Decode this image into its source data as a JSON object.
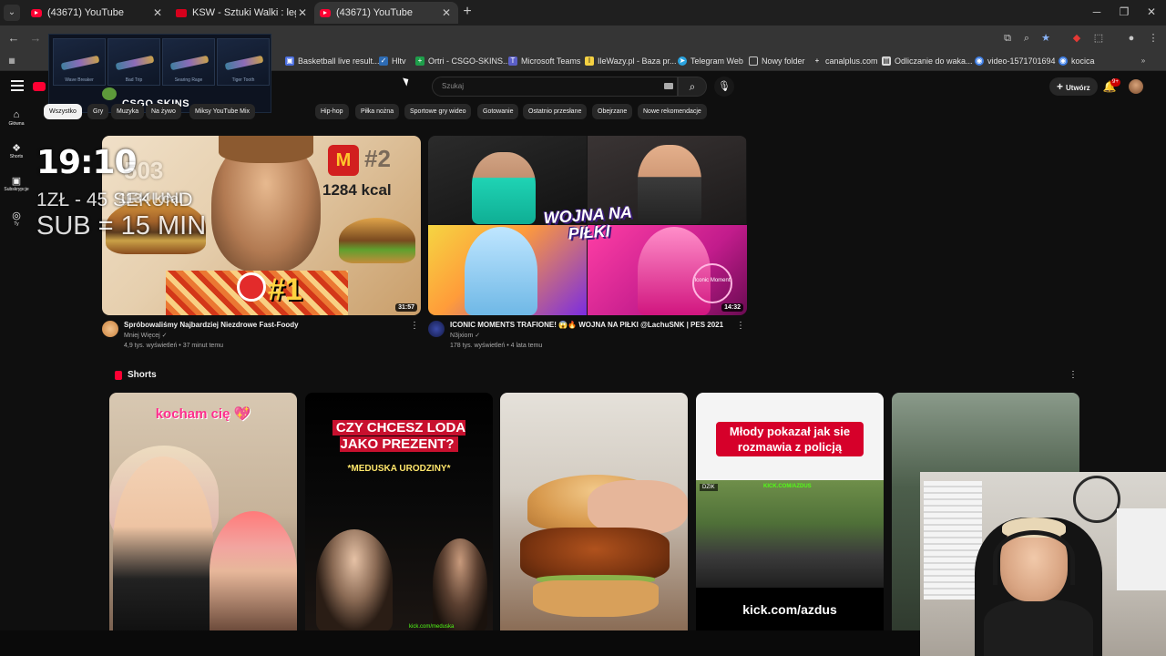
{
  "browser": {
    "tabs": [
      {
        "title": "(43671) YouTube",
        "favicon": "youtube-icon",
        "active": false
      },
      {
        "title": "KSW - Sztuki Walki : legalny bu",
        "favicon": "ksw-icon",
        "active": false
      },
      {
        "title": "(43671) YouTube",
        "favicon": "youtube-icon",
        "active": true
      }
    ],
    "new_tab": "+",
    "window_controls": {
      "minimize": "─",
      "maximize": "❐",
      "close": "✕"
    },
    "bookmarks": [
      {
        "label": "Basketball live result..."
      },
      {
        "label": "Hltv"
      },
      {
        "label": "Ortri - CSGO-SKINS..."
      },
      {
        "label": "Microsoft Teams"
      },
      {
        "label": "IleWazy.pl - Baza pr..."
      },
      {
        "label": "Telegram Web"
      },
      {
        "label": "Nowy folder"
      },
      {
        "label": "canalplus.com"
      },
      {
        "label": "Odliczanie do waka..."
      },
      {
        "label": "video-1571701694"
      },
      {
        "label": "kocica"
      }
    ]
  },
  "overlay_ad": {
    "brand": "CSGO SKINS",
    "items": [
      "Wave Breaker",
      "Bad Trip",
      "Searing Rage",
      "Tiger Tooth"
    ]
  },
  "overlay_stream": {
    "clock": "19:10",
    "clock_faded": "503",
    "line1": "1ZŁ - 45 SEKUND",
    "line1_faded": "1134 kcal",
    "line2": "SUB = 15 MIN"
  },
  "youtube": {
    "search_placeholder": "Szukaj",
    "create_label": "Utwórz",
    "notif_count": "9+",
    "sidebar": [
      {
        "label": "Główna",
        "icon": "home-icon"
      },
      {
        "label": "Shorts",
        "icon": "shorts-icon"
      },
      {
        "label": "Subskrypcje",
        "icon": "subscriptions-icon"
      },
      {
        "label": "Ty",
        "icon": "you-icon"
      }
    ],
    "chips": [
      "Wszystko",
      "Gry",
      "Muzyka",
      "Na żywo",
      "Miksy YouTube Mix",
      "Hip-hop",
      "Piłka nożna",
      "Sportowe gry wideo",
      "Gotowanie",
      "Ostatnio przesłane",
      "Obejrzane",
      "Nowe rekomendacje"
    ],
    "videos": [
      {
        "title": "Spróbowaliśmy Najbardziej Niezdrowe Fast-Foody",
        "channel": "Mniej Więcej",
        "stats": "4,9 tys. wyświetleń • 37 minut temu",
        "duration": "31:57",
        "thumb_text": {
          "rank2": "#2",
          "kcal": "1284 kcal",
          "rank1": "#1",
          "mcd": "M"
        }
      },
      {
        "title": "ICONIC MOMENTS TRAFIONE! 😱🔥 WOJNA NA PIŁKI @LachuSNK | PES 2021",
        "channel": "N3jxiom",
        "stats": "178 tys. wyświetleń • 4 lata temu",
        "duration": "14:32",
        "thumb_text": {
          "title": "WOJNA NA PIŁKI",
          "badge": "Iconic Moment"
        }
      }
    ],
    "shorts_title": "Shorts",
    "shorts": [
      {
        "caption": "kocham cię 💖"
      },
      {
        "caption": "CZY CHCESZ LODA JAKO PREZENT?",
        "sub": "*MEDUSKA URODZINY*",
        "watermark": "kick.com/meduska"
      },
      {
        "caption": ""
      },
      {
        "caption": "Młody pokazał jak sie rozmawia z policją",
        "badge": "DZIK",
        "kick_top": "KICK.COM/AZDUS",
        "kick_bottom": "kick.com/azdus"
      },
      {
        "caption": ""
      }
    ]
  }
}
